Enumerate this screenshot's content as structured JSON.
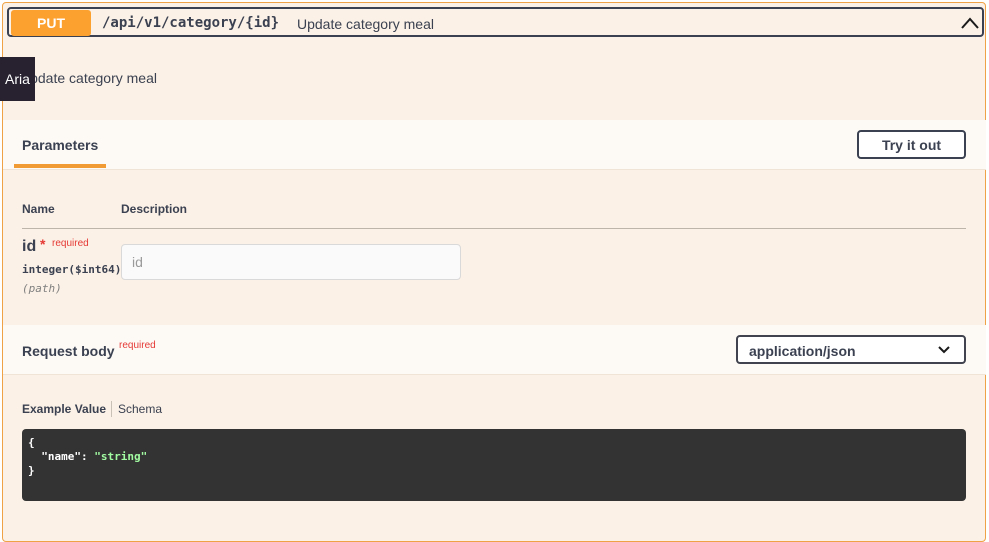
{
  "operation": {
    "method": "PUT",
    "path": "/api/v1/category/{id}",
    "summary": "Update category meal",
    "description": "Update category meal"
  },
  "tooltip": {
    "text": "Aria"
  },
  "parameters": {
    "tab_label": "Parameters",
    "try_button": "Try it out",
    "col_name": "Name",
    "col_description": "Description",
    "items": [
      {
        "name": "id",
        "required_star": "*",
        "required_label": "required",
        "type": "integer($int64)",
        "in": "(path)",
        "placeholder": "id",
        "value": ""
      }
    ]
  },
  "request_body": {
    "title": "Request body",
    "required_label": "required",
    "content_type": "application/json",
    "tabs": {
      "example": "Example Value",
      "schema": "Schema"
    },
    "example": {
      "open": "{",
      "key": "\"name\"",
      "colon": ": ",
      "value": "\"string\"",
      "close": "}"
    }
  },
  "colors": {
    "put": "#fca130",
    "required": "#e53935",
    "code_bg": "#333333",
    "code_string": "#a2fca2"
  },
  "icons": {
    "collapse": "chevron-up-icon",
    "select": "chevron-down-icon"
  }
}
